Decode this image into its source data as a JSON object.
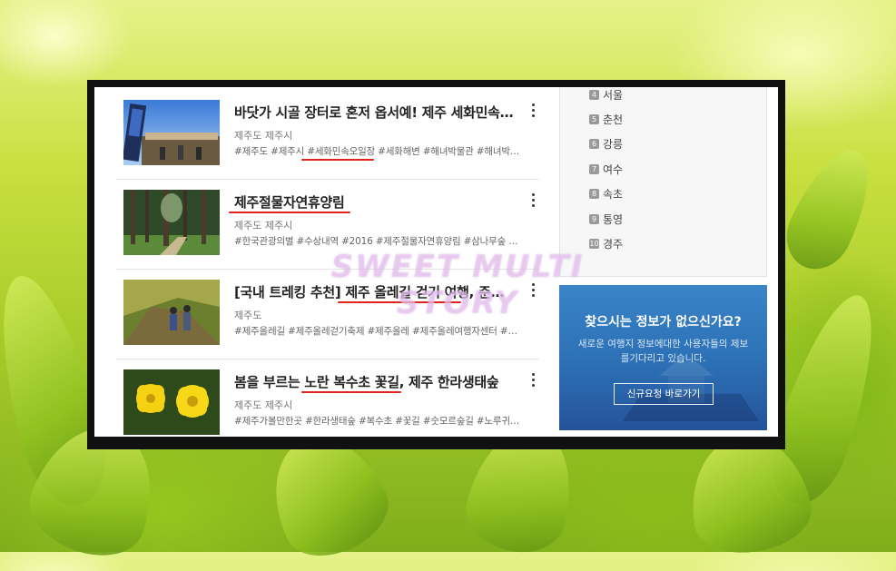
{
  "items": [
    {
      "title": "바닷가 시골 장터로 혼저 옵서예! 제주 세화민속…",
      "location": "제주도 제주시",
      "tags": "#제주도 #제주시 #세화민속오일장 #세화해변 #해녀박물관 #해녀박…"
    },
    {
      "title": "제주절물자연휴양림",
      "location": "제주도 제주시",
      "tags": "#한국관광의별 #수상내역 #2016 #제주절물자연휴양림 #삼나무숲 #…"
    },
    {
      "title": "[국내 트레킹 추천] 제주 올레길 걷기 여행, 준비…",
      "location": "제주도",
      "tags": "#제주올레길 #제주올레걷기축제 #제주올레 #제주올레여행자센터 #…"
    },
    {
      "title": "봄을 부르는 노란 복수초 꽃길, 제주 한라생태숲",
      "location": "제주도 제주시",
      "tags": "#제주가볼만한곳 #한라생태숲 #복수초 #꽃길 #숫모르숲길 #노루귀…"
    }
  ],
  "ranking": [
    {
      "num": "4",
      "name": "서울"
    },
    {
      "num": "5",
      "name": "춘천"
    },
    {
      "num": "6",
      "name": "강릉"
    },
    {
      "num": "7",
      "name": "여수"
    },
    {
      "num": "8",
      "name": "속초"
    },
    {
      "num": "9",
      "name": "통영"
    },
    {
      "num": "10",
      "name": "경주"
    }
  ],
  "promo": {
    "title": "찾으시는 정보가 없으신가요?",
    "desc": "새로운 여행지 정보에대한 사용자들의 제보를기다리고 있습니다.",
    "button": "신규요청 바로가기"
  },
  "watermark": "SWEET MULTI STORY",
  "colors": {
    "underline": "#e0231c",
    "promo": "#2c6fb4",
    "frame": "#111111"
  }
}
